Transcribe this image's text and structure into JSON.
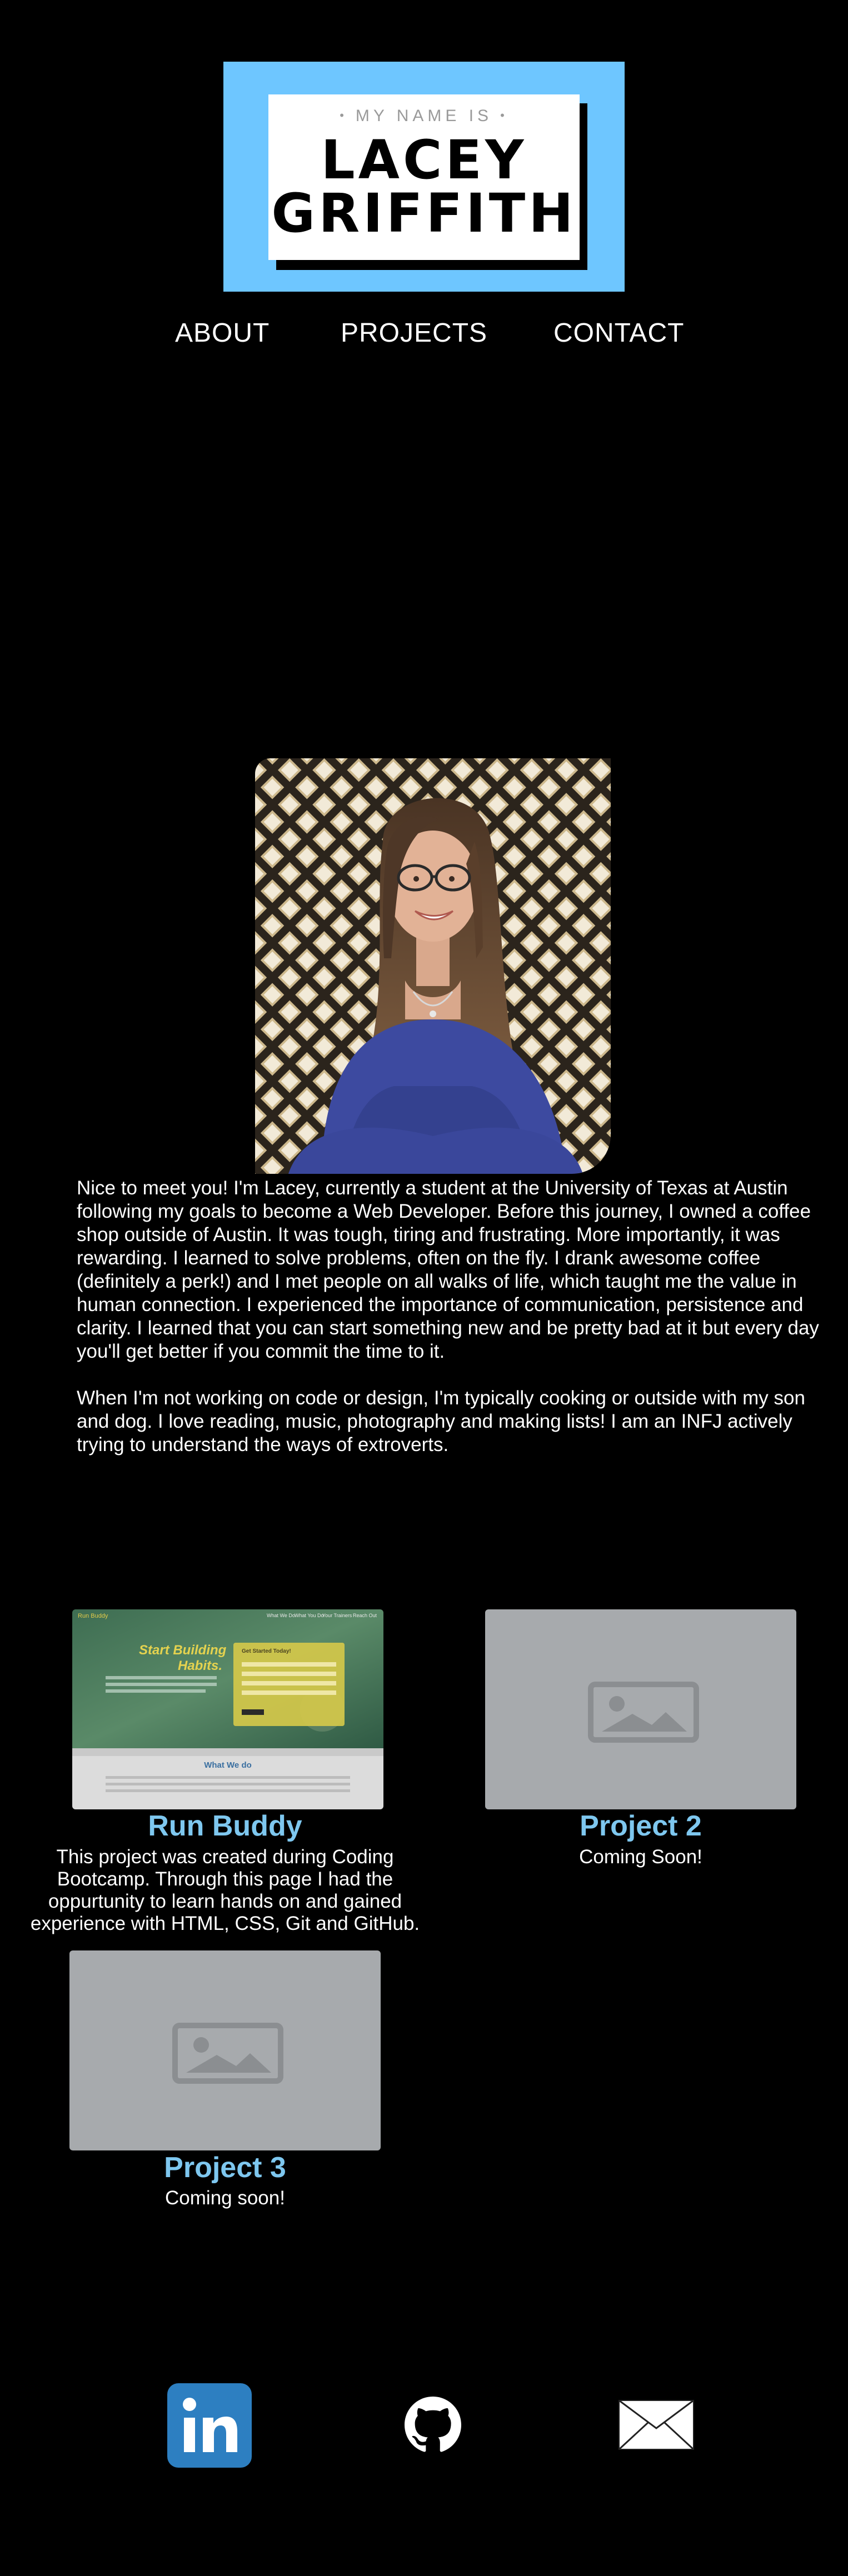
{
  "header": {
    "logo_pre": "MY NAME IS",
    "logo_first_name": "LACEY",
    "logo_last_name": "GRIFFITH",
    "logo_bg_color": "#6ec6ff"
  },
  "nav": {
    "items": [
      {
        "label": "ABOUT"
      },
      {
        "label": "PROJECTS"
      },
      {
        "label": "CONTACT"
      }
    ]
  },
  "about": {
    "photo_icon": "profile-photo",
    "paragraphs": [
      "Nice to meet you! I'm Lacey, currently a student at the University of Texas at Austin following my goals to become a Web Developer. Before this journey, I owned a coffee shop outside of Austin. It was tough, tiring and frustrating. More importantly, it was rewarding. I learned to solve problems, often on the fly. I drank awesome coffee (definitely a perk!) and I met people on all walks of life, which taught me the value in human connection. I experienced the importance of communication, persistence and clarity. I learned that you can start something new and be pretty bad at it but every day you'll get better if you commit the time to it.",
      "When I'm not working on code or design, I'm typically cooking or outside with my son and dog. I love reading, music, photography and making lists! I am an INFJ actively trying to understand the ways of extroverts."
    ]
  },
  "projects": {
    "accent_color": "#7ec7ef",
    "items": [
      {
        "title": "Run Buddy",
        "description": "This project was created during Coding Bootcamp. Through this page I had the oppurtunity to learn hands on and gained experience with HTML, CSS, Git and GitHub.",
        "thumb": {
          "brand": "Run Buddy",
          "nav": [
            "What We Do",
            "What You Do",
            "Your Trainers",
            "Reach Out"
          ],
          "hero_line1": "Start Building",
          "hero_line2": "Habits.",
          "form_title": "Get Started Today!",
          "section_title": "What We do"
        }
      },
      {
        "title": "Project 2",
        "description": "Coming Soon!",
        "thumb_icon": "image-placeholder-icon"
      },
      {
        "title": "Project 3",
        "description": "Coming soon!",
        "thumb_icon": "image-placeholder-icon"
      }
    ]
  },
  "footer": {
    "icons": [
      "linkedin-icon",
      "github-icon",
      "email-icon"
    ],
    "linkedin_color": "#2d7fc1"
  }
}
